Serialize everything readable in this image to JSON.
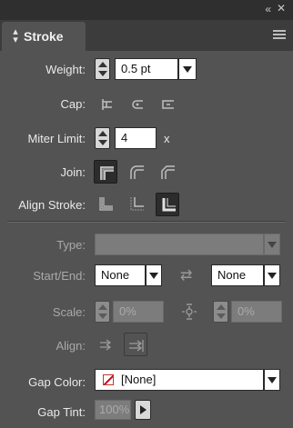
{
  "panel": {
    "title": "Stroke",
    "collapse_glyph": "«",
    "close_glyph": "✕",
    "menu_icon": "panel-menu-icon"
  },
  "weight": {
    "label": "Weight:",
    "value": "0.5 pt"
  },
  "cap": {
    "label": "Cap:",
    "options": [
      "butt-cap",
      "round-cap",
      "projecting-cap"
    ]
  },
  "miter": {
    "label": "Miter Limit:",
    "value": "4",
    "unit": "x"
  },
  "join": {
    "label": "Join:",
    "options": [
      "miter-join",
      "round-join",
      "bevel-join"
    ],
    "selected": "miter-join"
  },
  "align_stroke": {
    "label": "Align Stroke:",
    "options": [
      "align-center",
      "align-inside",
      "align-outside"
    ],
    "selected": "align-outside"
  },
  "type": {
    "label": "Type:",
    "value": ""
  },
  "start_end": {
    "label": "Start/End:",
    "start": "None",
    "end": "None"
  },
  "scale": {
    "label": "Scale:",
    "start": "0%",
    "end": "0%"
  },
  "align": {
    "label": "Align:"
  },
  "gap_color": {
    "label": "Gap Color:",
    "value": "[None]"
  },
  "gap_tint": {
    "label": "Gap Tint:",
    "value": "100%"
  }
}
